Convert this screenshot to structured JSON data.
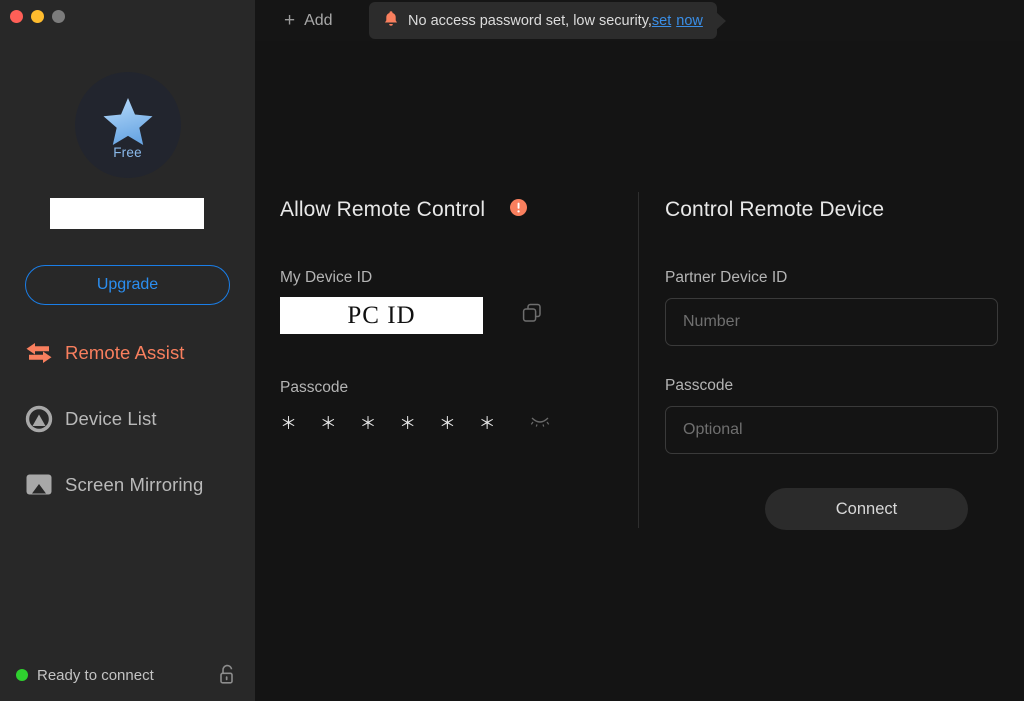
{
  "window": {
    "traffic_lights": [
      "close",
      "minimize",
      "zoom"
    ]
  },
  "sidebar": {
    "account_badge": {
      "plan_label": "Free",
      "star_color": "#9ccaf4",
      "circle_color": "#22252e"
    },
    "account_name_redacted": "",
    "upgrade_label": "Upgrade",
    "accent_color": "#2b8ef0",
    "items": [
      {
        "label": "Remote Assist",
        "icon": "two-way-arrows-icon",
        "active": true,
        "color": "#f97f5e"
      },
      {
        "label": "Device List",
        "icon": "device-list-icon",
        "active": false,
        "color": "#b9b9b9"
      },
      {
        "label": "Screen Mirroring",
        "icon": "screen-mirroring-icon",
        "active": false,
        "color": "#b9b9b9"
      }
    ],
    "status": {
      "text": "Ready to connect",
      "dot_color": "#2fd02f",
      "lock_icon": "unlocked-padlock-icon"
    }
  },
  "topbar": {
    "add_label": "Add",
    "add_icon": "plus-icon",
    "notice": {
      "bell_icon": "bell-icon",
      "message": "No access password set, low security,",
      "link_1": "set",
      "link_2": "now",
      "link_color": "#3a8ee6"
    }
  },
  "allow_remote_control": {
    "title": "Allow Remote Control",
    "warning_icon": "warning-exclamation-icon",
    "warning_color": "#f97f5e",
    "device_id_label": "My Device ID",
    "device_id_value": "PC ID",
    "copy_icon": "copy-icon",
    "passcode_label": "Passcode",
    "passcode_masked": "＊ ＊ ＊ ＊ ＊ ＊",
    "reveal_icon": "eye-closed-icon"
  },
  "control_remote_device": {
    "title": "Control Remote Device",
    "partner_id_label": "Partner Device ID",
    "partner_id_placeholder": "Number",
    "partner_id_value": "",
    "passcode_label": "Passcode",
    "passcode_placeholder": "Optional",
    "passcode_value": "",
    "connect_label": "Connect"
  }
}
